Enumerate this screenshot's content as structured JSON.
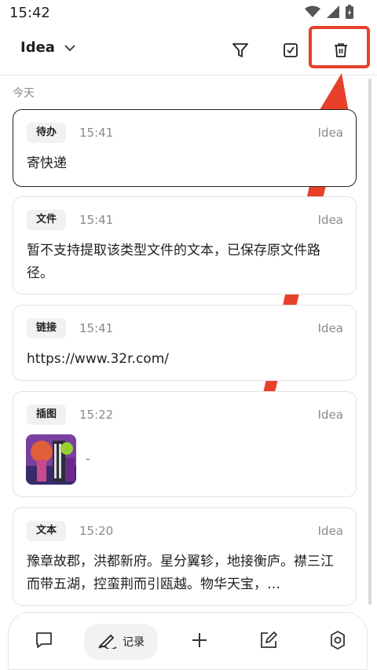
{
  "status_bar": {
    "time": "15:42"
  },
  "toolbar": {
    "notebook": "Idea",
    "filter_icon": "filter-icon",
    "select_icon": "checkbox-icon",
    "delete_icon": "trash-icon",
    "highlight_color": "#e8412b"
  },
  "section": {
    "label": "今天"
  },
  "cards": [
    {
      "tag": "待办",
      "time": "15:41",
      "source": "Idea",
      "content": "寄快递"
    },
    {
      "tag": "文件",
      "time": "15:41",
      "source": "Idea",
      "content": "暂不支持提取该类型文件的文本，已保存原文件路径。"
    },
    {
      "tag": "链接",
      "time": "15:41",
      "source": "Idea",
      "content": "https://www.32r.com/"
    },
    {
      "tag": "插图",
      "time": "15:22",
      "source": "Idea",
      "content": "-"
    },
    {
      "tag": "文本",
      "time": "15:20",
      "source": "Idea",
      "content": "豫章故郡，洪都新府。星分翼轸，地接衡庐。襟三江而带五湖，控蛮荆而引瓯越。物华天宝，…"
    }
  ],
  "bottom_nav": {
    "items": [
      "chat-icon",
      "records",
      "plus-icon",
      "edit-icon",
      "gear-icon"
    ],
    "records_label": "记录"
  }
}
